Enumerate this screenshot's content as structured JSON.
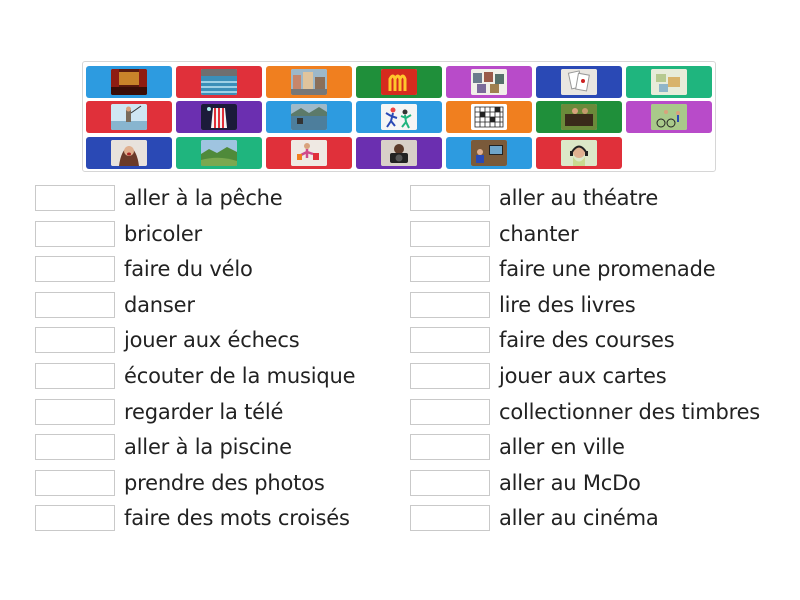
{
  "tiles": [
    {
      "name": "theatre-image-tile",
      "color": "#2d9be0",
      "icon": "theatre-stage"
    },
    {
      "name": "swimming-pool-image-tile",
      "color": "#e0303a",
      "icon": "pool"
    },
    {
      "name": "town-street-image-tile",
      "color": "#f07f1f",
      "icon": "town"
    },
    {
      "name": "mcdonalds-image-tile",
      "color": "#1f8f3a",
      "icon": "mcdonalds-logo"
    },
    {
      "name": "stamps-image-tile",
      "color": "#b84bc9",
      "icon": "stamps"
    },
    {
      "name": "playing-cards-image-tile",
      "color": "#2a49b5",
      "icon": "cards"
    },
    {
      "name": "puzzle-craft-image-tile",
      "color": "#1fb57e",
      "icon": "craft"
    },
    {
      "name": "fishing-image-tile",
      "color": "#e0303a",
      "icon": "fishing"
    },
    {
      "name": "cinema-image-tile",
      "color": "#6b2fb0",
      "icon": "cinema"
    },
    {
      "name": "cycling-lake-image-tile",
      "color": "#2d9be0",
      "icon": "lake"
    },
    {
      "name": "dancing-image-tile",
      "color": "#2d9be0",
      "icon": "dance"
    },
    {
      "name": "crossword-image-tile",
      "color": "#f07f1f",
      "icon": "crossword"
    },
    {
      "name": "chess-image-tile",
      "color": "#1f8f3a",
      "icon": "chess"
    },
    {
      "name": "bike-ride-image-tile",
      "color": "#b84bc9",
      "icon": "bikes"
    },
    {
      "name": "singing-image-tile",
      "color": "#2a49b5",
      "icon": "singer"
    },
    {
      "name": "countryside-walk-image-tile",
      "color": "#1fb57e",
      "icon": "landscape"
    },
    {
      "name": "shopping-image-tile",
      "color": "#e0303a",
      "icon": "shopping"
    },
    {
      "name": "camera-photo-image-tile",
      "color": "#6b2fb0",
      "icon": "camera"
    },
    {
      "name": "watching-tv-image-tile",
      "color": "#2d9be0",
      "icon": "tv"
    },
    {
      "name": "listening-music-image-tile",
      "color": "#e0303a",
      "icon": "headphones"
    }
  ],
  "left_items": [
    "aller à la pêche",
    "bricoler",
    "faire du vélo",
    "danser",
    "jouer aux échecs",
    "écouter de la musique",
    "regarder la télé",
    "aller à la piscine",
    "prendre des photos",
    "faire des mots croisés"
  ],
  "right_items": [
    "aller au théatre",
    "chanter",
    "faire une promenade",
    "lire des livres",
    "faire des courses",
    "jouer aux cartes",
    "collectionner des timbres",
    "aller en ville",
    "aller au McDo",
    "aller au cinéma"
  ]
}
